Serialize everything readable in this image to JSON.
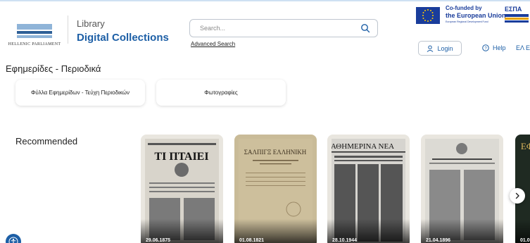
{
  "header": {
    "logo_text": "HELLENIC PARLIAMENT",
    "library_label": "Library",
    "site_title": "Digital Collections",
    "search_placeholder": "Search...",
    "advanced_search": "Advanced Search",
    "eu_line1": "Co-funded by",
    "eu_line2": "the European Union",
    "eu_line3": "European Regional Development Fund",
    "espa_label": "ΕΣΠΑ",
    "login_label": "Login",
    "help_label": "Help",
    "lang_label": "ΕΛ EN"
  },
  "categories": {
    "title": "Εφημερίδες - Περιοδικά",
    "items": [
      {
        "label": "Φύλλα Εφημερίδων - Τεύχη Περιοδικών"
      },
      {
        "label": "Φωτογραφίες"
      }
    ]
  },
  "recommended": {
    "title": "Recommended",
    "items": [
      {
        "date": "29.06.1875",
        "masthead": "ΤΙ ΠΤΑΙΕΙ"
      },
      {
        "date": "01.08.1821",
        "masthead": "ΣΑΛΠΙΓΞ ΕΛΛΗΝΙΚΗ"
      },
      {
        "date": "28.10.1944",
        "masthead": "ΚΑΘΗΜΕΡΙΝΑ ΝΕΑ"
      },
      {
        "date": "21.04.1896",
        "masthead": ""
      },
      {
        "date": "01.0",
        "masthead": "ΕΦ"
      }
    ]
  },
  "colors": {
    "accent": "#1d5fa6",
    "eu_blue": "#1a3d9b"
  },
  "icons": {
    "search": "search-icon",
    "login": "user-icon",
    "help": "help-circle-icon",
    "next": "chevron-right-icon",
    "accessibility": "accessibility-icon"
  }
}
